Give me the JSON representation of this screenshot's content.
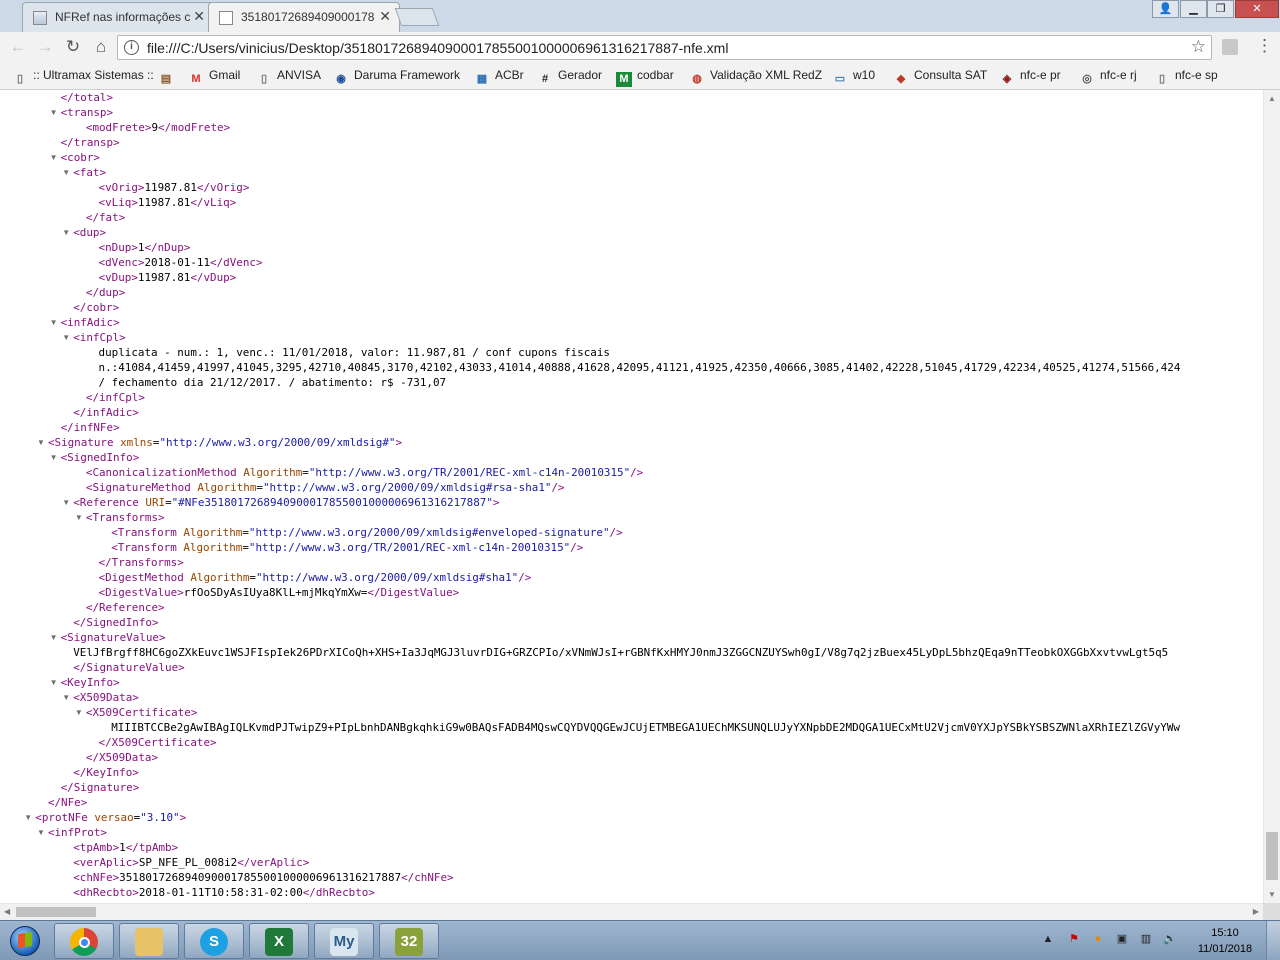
{
  "browser": {
    "tabs": [
      {
        "title": "NFRef nas informações c",
        "active": false
      },
      {
        "title": "35180172689409000178",
        "active": true
      }
    ],
    "url": "file:///C:/Users/vinicius/Desktop/35180172689409000178550010000069613162178​87-nfe.xml",
    "bookmarks": [
      {
        "label": ":: Ultramax Sistemas ::",
        "icon": "page-icon"
      },
      {
        "label": "",
        "icon": "image-icon"
      },
      {
        "label": "Gmail",
        "icon": "gmail-icon"
      },
      {
        "label": "ANVISA",
        "icon": "page-icon"
      },
      {
        "label": "Daruma Framework",
        "icon": "daruma-icon"
      },
      {
        "label": "ACBr",
        "icon": "acbr-icon"
      },
      {
        "label": "Gerador",
        "icon": "gerador-icon"
      },
      {
        "label": "codbar",
        "icon": "codbar-icon"
      },
      {
        "label": "Validação XML RedZ",
        "icon": "validacao-icon"
      },
      {
        "label": "w10",
        "icon": "w10-icon"
      },
      {
        "label": "Consulta SAT",
        "icon": "sat-icon"
      },
      {
        "label": "nfc-e pr",
        "icon": "pr-seal-icon"
      },
      {
        "label": "nfc-e rj",
        "icon": "rj-seal-icon"
      },
      {
        "label": "nfc-e sp",
        "icon": "page-icon"
      }
    ]
  },
  "xml_lines": [
    {
      "ind": 4,
      "arrow": false,
      "text": "</total>",
      "kind": "tag"
    },
    {
      "ind": 4,
      "arrow": true,
      "text": "<transp>",
      "kind": "tag"
    },
    {
      "ind": 6,
      "arrow": false,
      "text": "<modFrete>9</modFrete>",
      "kind": "inline"
    },
    {
      "ind": 4,
      "arrow": false,
      "text": "</transp>",
      "kind": "tag"
    },
    {
      "ind": 4,
      "arrow": true,
      "text": "<cobr>",
      "kind": "tag"
    },
    {
      "ind": 5,
      "arrow": true,
      "text": "<fat>",
      "kind": "tag"
    },
    {
      "ind": 7,
      "arrow": false,
      "text": "<vOrig>11987.81</vOrig>",
      "kind": "inline"
    },
    {
      "ind": 7,
      "arrow": false,
      "text": "<vLiq>11987.81</vLiq>",
      "kind": "inline"
    },
    {
      "ind": 6,
      "arrow": false,
      "text": "</fat>",
      "kind": "tag"
    },
    {
      "ind": 5,
      "arrow": true,
      "text": "<dup>",
      "kind": "tag"
    },
    {
      "ind": 7,
      "arrow": false,
      "text": "<nDup>1</nDup>",
      "kind": "inline"
    },
    {
      "ind": 7,
      "arrow": false,
      "text": "<dVenc>2018-01-11</dVenc>",
      "kind": "inline"
    },
    {
      "ind": 7,
      "arrow": false,
      "text": "<vDup>11987.81</vDup>",
      "kind": "inline"
    },
    {
      "ind": 6,
      "arrow": false,
      "text": "</dup>",
      "kind": "tag"
    },
    {
      "ind": 5,
      "arrow": false,
      "text": "</cobr>",
      "kind": "tag"
    },
    {
      "ind": 4,
      "arrow": true,
      "text": "<infAdic>",
      "kind": "tag"
    },
    {
      "ind": 5,
      "arrow": true,
      "text": "<infCpl>",
      "kind": "tag"
    },
    {
      "ind": 7,
      "arrow": false,
      "text": "duplicata - num.: 1, venc.: 11/01/2018, valor: 11.987,81 / conf cupons fiscais",
      "kind": "text"
    },
    {
      "ind": 7,
      "arrow": false,
      "text": "n.:41084,41459,41997,41045,3295,42710,40845,3170,42102,43033,41014,40888,41628,42095,41121,41925,42350,40666,3085,41402,42228,51045,41729,42234,40525,41274,51566,424",
      "kind": "text"
    },
    {
      "ind": 7,
      "arrow": false,
      "text": "/ fechamento dia 21/12/2017. / abatimento: r$ -731,07",
      "kind": "text"
    },
    {
      "ind": 6,
      "arrow": false,
      "text": "</infCpl>",
      "kind": "tag"
    },
    {
      "ind": 5,
      "arrow": false,
      "text": "</infAdic>",
      "kind": "tag"
    },
    {
      "ind": 4,
      "arrow": false,
      "text": "</infNFe>",
      "kind": "tag"
    },
    {
      "ind": 3,
      "arrow": true,
      "text": "<Signature xmlns=\"http://www.w3.org/2000/09/xmldsig#\">",
      "kind": "attr"
    },
    {
      "ind": 4,
      "arrow": true,
      "text": "<SignedInfo>",
      "kind": "tag"
    },
    {
      "ind": 6,
      "arrow": false,
      "text": "<CanonicalizationMethod Algorithm=\"http://www.w3.org/TR/2001/REC-xml-c14n-20010315\"/>",
      "kind": "attr"
    },
    {
      "ind": 6,
      "arrow": false,
      "text": "<SignatureMethod Algorithm=\"http://www.w3.org/2000/09/xmldsig#rsa-sha1\"/>",
      "kind": "attr"
    },
    {
      "ind": 5,
      "arrow": true,
      "text": "<Reference URI=\"#NFe35180172689409000178550010000069613162178​87\">",
      "kind": "attr"
    },
    {
      "ind": 6,
      "arrow": true,
      "text": "<Transforms>",
      "kind": "tag"
    },
    {
      "ind": 8,
      "arrow": false,
      "text": "<Transform Algorithm=\"http://www.w3.org/2000/09/xmldsig#enveloped-signature\"/>",
      "kind": "attr"
    },
    {
      "ind": 8,
      "arrow": false,
      "text": "<Transform Algorithm=\"http://www.w3.org/TR/2001/REC-xml-c14n-20010315\"/>",
      "kind": "attr"
    },
    {
      "ind": 7,
      "arrow": false,
      "text": "</Transforms>",
      "kind": "tag"
    },
    {
      "ind": 7,
      "arrow": false,
      "text": "<DigestMethod Algorithm=\"http://www.w3.org/2000/09/xmldsig#sha1\"/>",
      "kind": "attr"
    },
    {
      "ind": 7,
      "arrow": false,
      "text": "<DigestValue>rfOoSDyAsIUya8KlL+mjMkqYmXw=</DigestValue>",
      "kind": "inline"
    },
    {
      "ind": 6,
      "arrow": false,
      "text": "</Reference>",
      "kind": "tag"
    },
    {
      "ind": 5,
      "arrow": false,
      "text": "</SignedInfo>",
      "kind": "tag"
    },
    {
      "ind": 4,
      "arrow": true,
      "text": "<SignatureValue>",
      "kind": "tag"
    },
    {
      "ind": 5,
      "arrow": false,
      "text": "VElJfBrgff8HC6goZXkEuvc1WSJFIspIek26PDrXICoQh+XHS+Ia3JqMGJ3luvrDIG+GRZCPIo/xVNmWJsI+rGBNfKxHMYJ0nmJ3ZGGCNZUYSwh0gI/V8g7q2jzBuex45LyDpL5bhzQEqa9nTTeobkOXGGbXxvtvwLgt5q5",
      "kind": "text"
    },
    {
      "ind": 5,
      "arrow": false,
      "text": "</SignatureValue>",
      "kind": "tag"
    },
    {
      "ind": 4,
      "arrow": true,
      "text": "<KeyInfo>",
      "kind": "tag"
    },
    {
      "ind": 5,
      "arrow": true,
      "text": "<X509Data>",
      "kind": "tag"
    },
    {
      "ind": 6,
      "arrow": true,
      "text": "<X509Certificate>",
      "kind": "tag"
    },
    {
      "ind": 8,
      "arrow": false,
      "text": "MIIIBTCCBe2gAwIBAgIQLKvmdPJTwipZ9+PIpLbnhDANBgkqhkiG9w0BAQsFADB4MQswCQYDVQQGEwJCUjETMBEGA1UEChMKSUNQLUJyYXNpbDE2MDQGA1UECxMtU2VjcmV0YXJpYSBkYSBSZWNlaXRhIEZlZGVyYWw",
      "kind": "text"
    },
    {
      "ind": 7,
      "arrow": false,
      "text": "</X509Certificate>",
      "kind": "tag"
    },
    {
      "ind": 6,
      "arrow": false,
      "text": "</X509Data>",
      "kind": "tag"
    },
    {
      "ind": 5,
      "arrow": false,
      "text": "</KeyInfo>",
      "kind": "tag"
    },
    {
      "ind": 4,
      "arrow": false,
      "text": "</Signature>",
      "kind": "tag"
    },
    {
      "ind": 3,
      "arrow": false,
      "text": "</NFe>",
      "kind": "tag"
    },
    {
      "ind": 2,
      "arrow": true,
      "text": "<protNFe versao=\"3.10\">",
      "kind": "attr"
    },
    {
      "ind": 3,
      "arrow": true,
      "text": "<infProt>",
      "kind": "tag"
    },
    {
      "ind": 5,
      "arrow": false,
      "text": "<tpAmb>1</tpAmb>",
      "kind": "inline"
    },
    {
      "ind": 5,
      "arrow": false,
      "text": "<verAplic>SP_NFE_PL_008i2</verAplic>",
      "kind": "inline"
    },
    {
      "ind": 5,
      "arrow": false,
      "text": "<chNFe>35180172689409000178550010000069613162178​87</chNFe>",
      "kind": "inline"
    },
    {
      "ind": 5,
      "arrow": false,
      "text": "<dhRecbto>2018-01-11T10:58:31-02:00</dhRecbto>",
      "kind": "inline"
    }
  ],
  "taskbar": {
    "apps": [
      {
        "name": "chrome",
        "label": "",
        "color": "#e9b02a"
      },
      {
        "name": "explorer",
        "label": "",
        "color": "#e8c267"
      },
      {
        "name": "skype",
        "label": "S",
        "color": "#1ea1e2"
      },
      {
        "name": "excel",
        "label": "X",
        "color": "#1f7a3a"
      },
      {
        "name": "mysql",
        "label": "My",
        "color": "#d9e6ef"
      },
      {
        "name": "compiler",
        "label": "32",
        "color": "#8aa23a"
      }
    ],
    "time": "15:10",
    "date": "11/01/2018"
  }
}
